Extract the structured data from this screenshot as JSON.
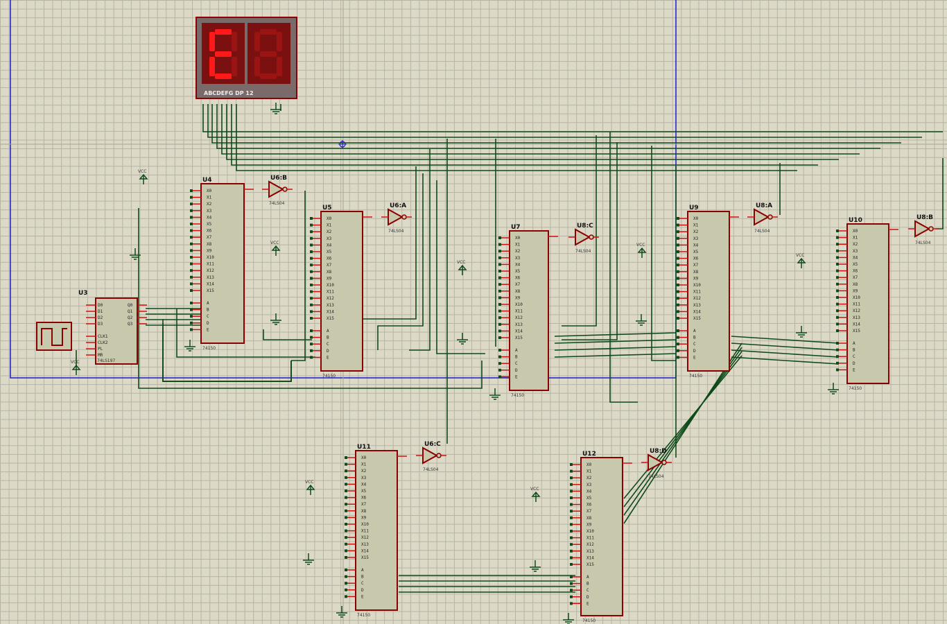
{
  "display": {
    "digits": [
      "8",
      "8"
    ],
    "segments_lit": [
      {
        "a": true,
        "b": false,
        "c": false,
        "d": true,
        "e": true,
        "f": true,
        "g": true
      },
      {
        "a": false,
        "b": false,
        "c": false,
        "d": false,
        "e": false,
        "f": false,
        "g": false
      }
    ],
    "pin_label": "ABCDEFG  DP    12"
  },
  "power_label": "VCC",
  "mux_type": "74150",
  "inverter_type": "74LS04",
  "counter": {
    "ref": "U3",
    "type": "74LS197",
    "pins": [
      "D0",
      "D1",
      "D2",
      "D3",
      "CLK1",
      "CLK2",
      "PL",
      "MR",
      "Q0",
      "Q1",
      "Q2",
      "Q3"
    ]
  },
  "mux_pins": [
    "X0",
    "X1",
    "X2",
    "X3",
    "X4",
    "X5",
    "X6",
    "X7",
    "X8",
    "X9",
    "X10",
    "X11",
    "X12",
    "X13",
    "X14",
    "X15",
    "A",
    "B",
    "C",
    "D",
    "E"
  ],
  "chips": [
    {
      "ref": "U4"
    },
    {
      "ref": "U5"
    },
    {
      "ref": "U7"
    },
    {
      "ref": "U9"
    },
    {
      "ref": "U10"
    },
    {
      "ref": "U11"
    },
    {
      "ref": "U12"
    }
  ],
  "inverters": [
    {
      "ref": "U6:B"
    },
    {
      "ref": "U6:A"
    },
    {
      "ref": "U6:C"
    },
    {
      "ref": "U8:A"
    },
    {
      "ref": "U8:B"
    },
    {
      "ref": "U8:C"
    },
    {
      "ref": "U8:D"
    }
  ],
  "colors": {
    "wire": "#0f4a1a",
    "chip_fill": "#c8c8ad",
    "chip_border": "#8b0000",
    "pin": "#d01010",
    "sheet": "#1a1ad0"
  }
}
